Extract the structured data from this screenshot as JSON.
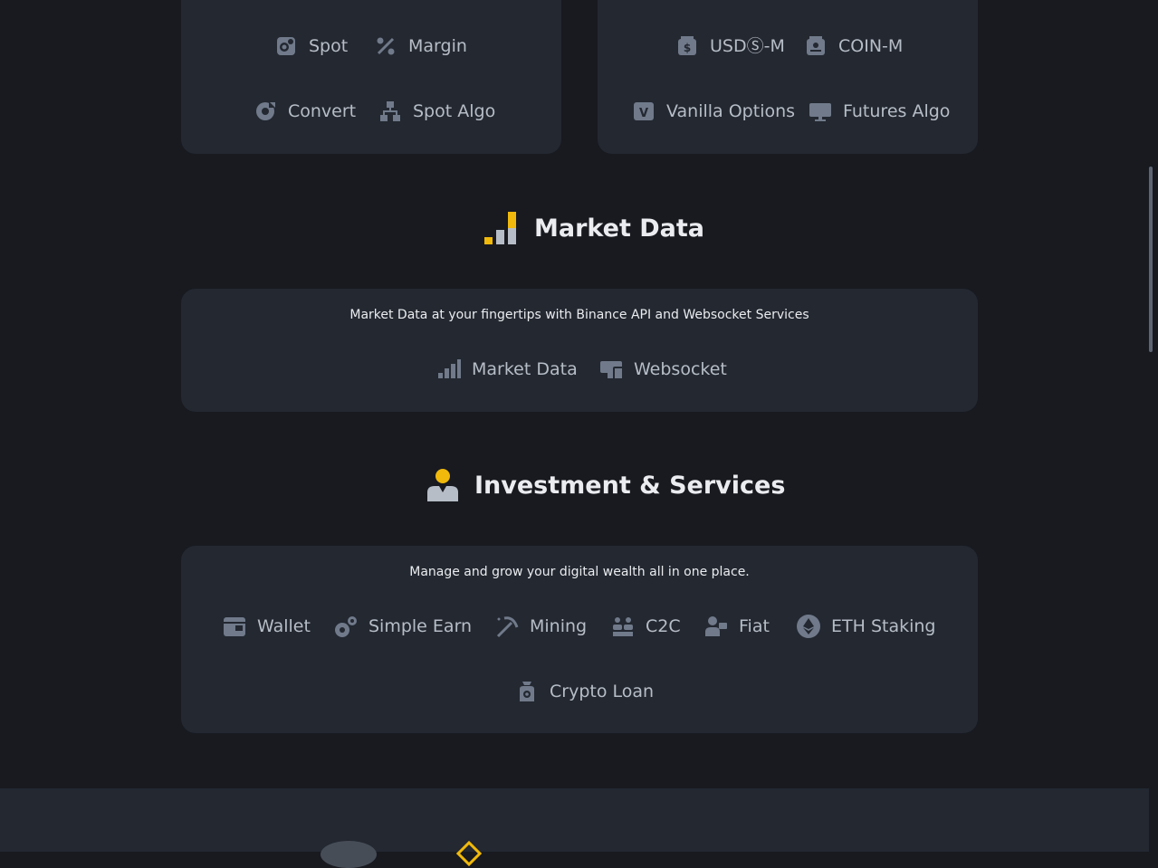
{
  "top_cards": {
    "spot": {
      "links": [
        {
          "label": "Spot",
          "icon": "spot-icon"
        },
        {
          "label": "Margin",
          "icon": "margin-icon"
        },
        {
          "label": "Convert",
          "icon": "convert-icon"
        },
        {
          "label": "Spot Algo",
          "icon": "spot-algo-icon"
        }
      ]
    },
    "futures": {
      "links": [
        {
          "label": "USDⓈ-M",
          "icon": "usds-m-icon"
        },
        {
          "label": "COIN-M",
          "icon": "coin-m-icon"
        },
        {
          "label": "Vanilla Options",
          "icon": "vanilla-options-icon"
        },
        {
          "label": "Futures Algo",
          "icon": "futures-algo-icon"
        }
      ]
    }
  },
  "market_data": {
    "title": "Market Data",
    "description": "Market Data at your fingertips with Binance API and Websocket Services",
    "links": [
      {
        "label": "Market Data",
        "icon": "bar-chart-icon"
      },
      {
        "label": "Websocket",
        "icon": "websocket-icon"
      }
    ]
  },
  "investment": {
    "title": "Investment & Services",
    "description": "Manage and grow your digital wealth all in one place.",
    "links": [
      {
        "label": "Wallet",
        "icon": "wallet-icon"
      },
      {
        "label": "Simple Earn",
        "icon": "simple-earn-icon"
      },
      {
        "label": "Mining",
        "icon": "mining-icon"
      },
      {
        "label": "C2C",
        "icon": "c2c-icon"
      },
      {
        "label": "Fiat",
        "icon": "fiat-icon"
      },
      {
        "label": "ETH Staking",
        "icon": "eth-icon"
      },
      {
        "label": "Crypto Loan",
        "icon": "crypto-loan-icon"
      }
    ]
  },
  "colors": {
    "background": "#181a20",
    "card": "#232831",
    "accent": "#f0b90b",
    "link_text": "#b7bdc6",
    "icon_gray": "#707a8a"
  }
}
